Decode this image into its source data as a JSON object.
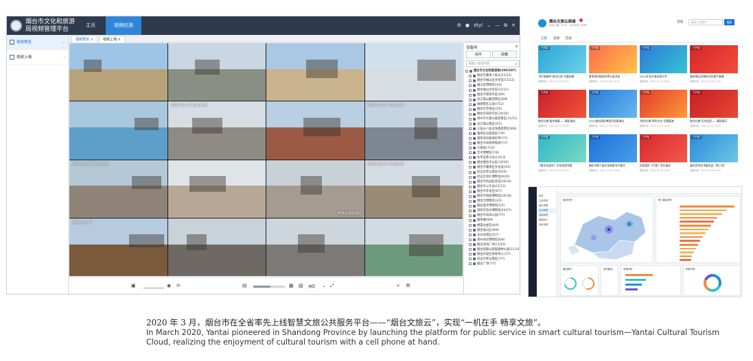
{
  "app": {
    "title": "烟台市文化和旅游局视频管理平台",
    "nav": {
      "home": "主页",
      "video_app": "视频应用"
    },
    "user": "dtyl",
    "sidebar": [
      {
        "label": "视频预览"
      },
      {
        "label": "视频上墙"
      }
    ],
    "page_tabs": [
      "视频预览 ×",
      "视频上墙 ×"
    ],
    "player": {
      "progress": 0.55,
      "mode": "满屏"
    },
    "device_panel": {
      "title": "设备树",
      "tabs": [
        "组件",
        "收藏"
      ],
      "search_placeholder": "请输入查询内容",
      "rows": [
        "烟台市文化和旅游局(500/587)",
        "烟台市蓬莱人民公(21/21)",
        "烟台市福山区文化馆(11/12)",
        "福山区博物馆(3/4)",
        "烟台福山文化馆(11/11)",
        "烟台市莱阳市区(9/9)",
        "龙口南山集团景区(8/8)",
        "融通景区公园(7/12)",
        "烟台市芝罘区(5/5)",
        "烟台市海阳市区(16/16)",
        "莱州市大基山旅游景区(11/11)",
        "龙口南山景区(5/5)",
        "三仙山八仙过海旅游景区(8/8)",
        "蓬莱长岛旅游区(7/9)",
        "蓬莱海洋极地世界(7/7)",
        "烟台市海参养殖场(7/7)",
        "大基层(7/12)",
        "艺术博物馆(7/8)",
        "牟平区养马岛(13/13)",
        "烟台烟台市山区(10/10)",
        "烟台市蓬莱区文化馆(5/5)",
        "招远市罗山景区(6/20)",
        "招远市金矿博物馆(9/20)",
        "烟台市抗战纪念馆(16/16)",
        "烟台市火车站(11/12)",
        "烟台市开发区(6/7)",
        "烟台市地质博物馆(16/16)",
        "烟台市博物馆(3/3)",
        "烟台美术博物馆(5/5)",
        "莱阳市恐龙博物馆(44/57)",
        "烟台市海滨公园(7/7)",
        "蓬莱阁(9/9)",
        "栖霞太虚宫(6/6)",
        "烟台福山区(8/8)",
        "长岛风景区(5/7)",
        "莱州海洋博物馆(6/8)",
        "烟台滨海广场(11/19)",
        "烟台昆嵛山国家森林公园(11/14)",
        "烟台开发区体育中心(7/7)",
        "招远市罗山景区(7/7)",
        "烟台广场(7/7)"
      ]
    },
    "cameras": [
      {
        "timestamp": "",
        "caption": ""
      },
      {
        "timestamp": "",
        "caption": ""
      },
      {
        "timestamp": "",
        "caption": ""
      },
      {
        "timestamp": "",
        "caption": ""
      },
      {
        "timestamp": "",
        "caption": ""
      },
      {
        "timestamp": "2020-12-17 12:18:36",
        "caption": ""
      },
      {
        "timestamp": "",
        "caption": ""
      },
      {
        "timestamp": "2020-12-17 12:18:36",
        "caption": ""
      },
      {
        "timestamp": "2020-12-17 12:18:35",
        "caption": ""
      },
      {
        "timestamp": "",
        "caption": ""
      },
      {
        "timestamp": "",
        "caption": "照停车场的球机"
      },
      {
        "timestamp": "2020-12-17 12:18:37",
        "caption": ""
      },
      {
        "timestamp": "2020-12-17",
        "caption": ""
      },
      {
        "timestamp": "",
        "caption": ""
      },
      {
        "timestamp": "",
        "caption": ""
      },
      {
        "timestamp": "",
        "caption": ""
      }
    ]
  },
  "portal": {
    "name": "烟台文旅云商城",
    "sub": "活动人数: 3478 · 今日访问: 8989",
    "select_label": "活动",
    "search_placeholder": "请输入关键字",
    "search_button": "搜索",
    "tabs": [
      "全部",
      "直播",
      "回放"
    ],
    "cards": [
      {
        "tag": "已开始",
        "title": "\"我\"穿越的\"海洋古迹\"主题创意",
        "meta": "直播时间：2021-07-15 10:00"
      },
      {
        "tag": "已开始",
        "title": "蓬莱海洋极地世界公益活动",
        "meta": "直播时间：2021-07-16 10:00"
      },
      {
        "tag": "已开始",
        "title": "2021年北方海岛音乐节",
        "meta": "直播时间：2021-07-17 10:00"
      },
      {
        "tag": "已开始",
        "title": "烟台福山非物质文化遗产展演",
        "meta": "直播时间：2021-07-18 10:00"
      },
      {
        "tag": "已开始",
        "title": "胶东红旗·烟台故事——精彩演出",
        "meta": "直播时间：2021-07-19 10:00"
      },
      {
        "tag": "已开始",
        "title": "2021烟台国际啤酒节闭幕演出",
        "meta": "直播时间：2021-07-20 10:00"
      },
      {
        "tag": "已开始",
        "title": "\"胶东红旗·革命文化\"主题展演",
        "meta": "直播时间：2021-07-21 10:00"
      },
      {
        "tag": "已开始",
        "title": "胶东红旗·百年征程——精彩展示",
        "meta": "直播时间：2021-07-22 10:00"
      },
      {
        "tag": "已开始",
        "title": "《胶东抗战史》文化旅游专题",
        "meta": "直播时间：2021-07-23 10:00"
      },
      {
        "tag": "已开始",
        "title": "烟台市第十届文化旅游节开幕式",
        "meta": "直播时间：2021-07-24 10:00"
      },
      {
        "tag": "已开始",
        "title": "文旅惠民《灯笼》音乐演出",
        "meta": "直播时间：2021-07-25 10:00"
      },
      {
        "tag": "已开始",
        "title": "烟台民间艺术展览会（第三季）",
        "meta": "直播时间：2021-07-26 10:00"
      }
    ]
  },
  "dashboard": {
    "side_items": [
      "首页",
      "文旅资源",
      "景区管理",
      "活动管理",
      "直播管理",
      "数据统计",
      "系统设置"
    ],
    "panels": {
      "map": "客流分布",
      "bars": "热门景区排行",
      "g1": "客流统计",
      "g2": "实时客流",
      "g3": "来源分析",
      "g4": "年龄分布"
    },
    "bar_values": [
      0.95,
      0.82,
      0.74,
      0.66,
      0.6,
      0.55,
      0.5,
      0.45,
      0.4,
      0.36,
      0.32,
      0.28,
      0.25,
      0.22,
      0.2
    ]
  },
  "caption": {
    "zh": "2020 年 3 月，烟台市在全省率先上线智慧文旅公共服务平台——“烟台文旅云”，实现“一机在手 畅享文旅”。",
    "en": "In March 2020, Yantai pioneered in Shandong Province by launching the platform for public service in smart cultural tourism—Yantai Cultural Tourism Cloud, realizing the enjoyment of cultural tourism with a cell phone at hand."
  }
}
